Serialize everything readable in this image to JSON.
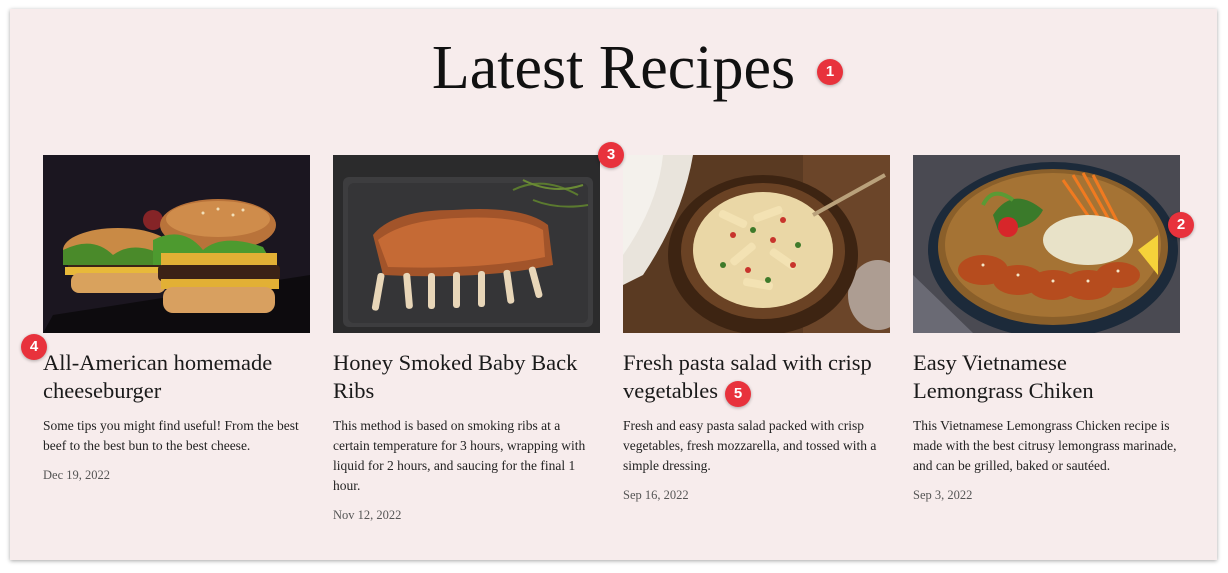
{
  "section": {
    "title": "Latest Recipes"
  },
  "recipes": [
    {
      "image": "cheeseburger-photo",
      "title": "All-American homemade cheeseburger",
      "description": "Some tips you might find useful! From the best beef to the best bun to the best cheese.",
      "date": "Dec 19, 2022"
    },
    {
      "image": "ribs-photo",
      "title": "Honey Smoked Baby Back Ribs",
      "description": "This method is based on smoking ribs at a certain temperature for 3 hours, wrapping with liquid for 2 hours, and saucing for the final 1 hour.",
      "date": "Nov 12, 2022"
    },
    {
      "image": "pasta-salad-photo",
      "title": "Fresh pasta salad with crisp vegetables",
      "description": "Fresh and easy pasta salad packed with crisp vegetables, fresh mozzarella, and tossed with a simple dressing.",
      "date": "Sep 16, 2022"
    },
    {
      "image": "lemongrass-chicken-photo",
      "title": "Easy Vietnamese Lemongrass Chiken",
      "description": "This Vietnamese Lemongrass Chicken recipe is made with the best citrusy lemongrass marinade, and can be grilled, baked or sautéed.",
      "date": "Sep 3, 2022"
    }
  ],
  "annotations": [
    "1",
    "2",
    "3",
    "4",
    "5"
  ],
  "colors": {
    "background": "#f7ecec",
    "badge": "#e8323c"
  }
}
